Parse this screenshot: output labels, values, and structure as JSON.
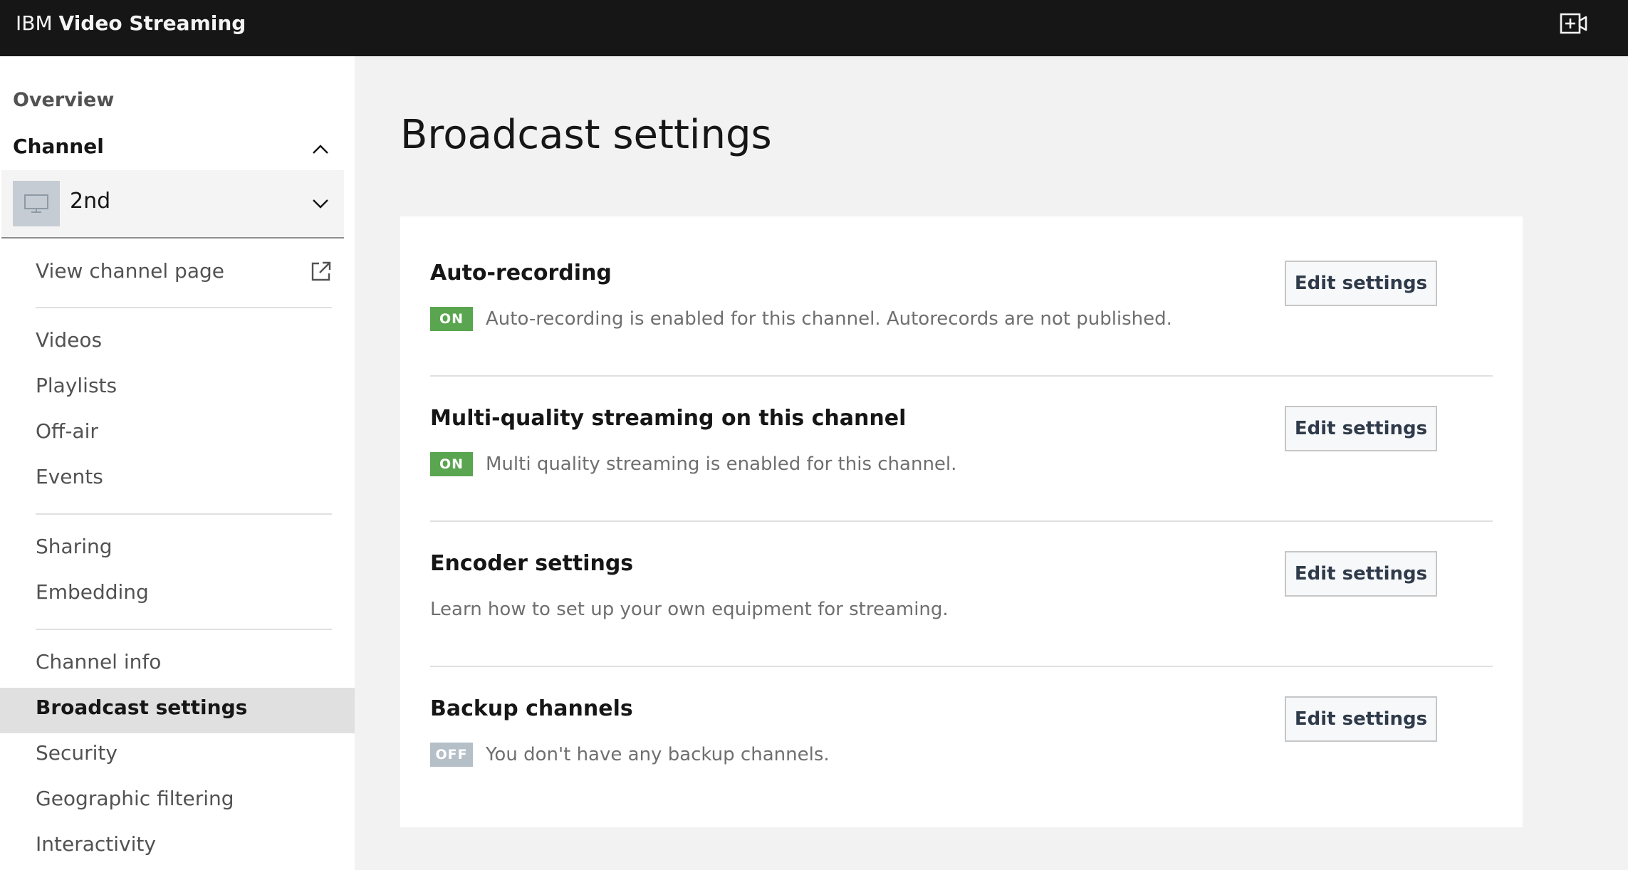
{
  "header": {
    "brand_prefix": "IBM",
    "brand_name": "Video Streaming",
    "action_icon": "add-video-icon"
  },
  "sidebar": {
    "overview": "Overview",
    "channel_heading": "Channel",
    "channel_selector": {
      "value": "2nd",
      "icon": "monitor-icon"
    },
    "view_channel_page": "View channel page",
    "groups": [
      [
        "Videos",
        "Playlists",
        "Off-air",
        "Events"
      ],
      [
        "Sharing",
        "Embedding"
      ],
      [
        "Channel info",
        "Broadcast settings",
        "Security",
        "Geographic filtering",
        "Interactivity"
      ]
    ],
    "active_item": "Broadcast settings"
  },
  "main": {
    "title": "Broadcast settings",
    "sections": [
      {
        "title": "Auto-recording",
        "status": "ON",
        "description": "Auto-recording is enabled for this channel. Autorecords are not published.",
        "button": "Edit settings"
      },
      {
        "title": "Multi-quality streaming on this channel",
        "status": "ON",
        "description": "Multi quality streaming is enabled for this channel.",
        "button": "Edit settings"
      },
      {
        "title": "Encoder settings",
        "status": "",
        "description": "Learn how to set up your own equipment for streaming.",
        "button": "Edit settings"
      },
      {
        "title": "Backup channels",
        "status": "OFF",
        "description": "You don't have any backup channels.",
        "button": "Edit settings"
      }
    ]
  },
  "colors": {
    "topbar": "#161616",
    "status_on": "#5aa54f",
    "status_off": "#b5bfc8",
    "active_nav": "#e0e0e0"
  }
}
